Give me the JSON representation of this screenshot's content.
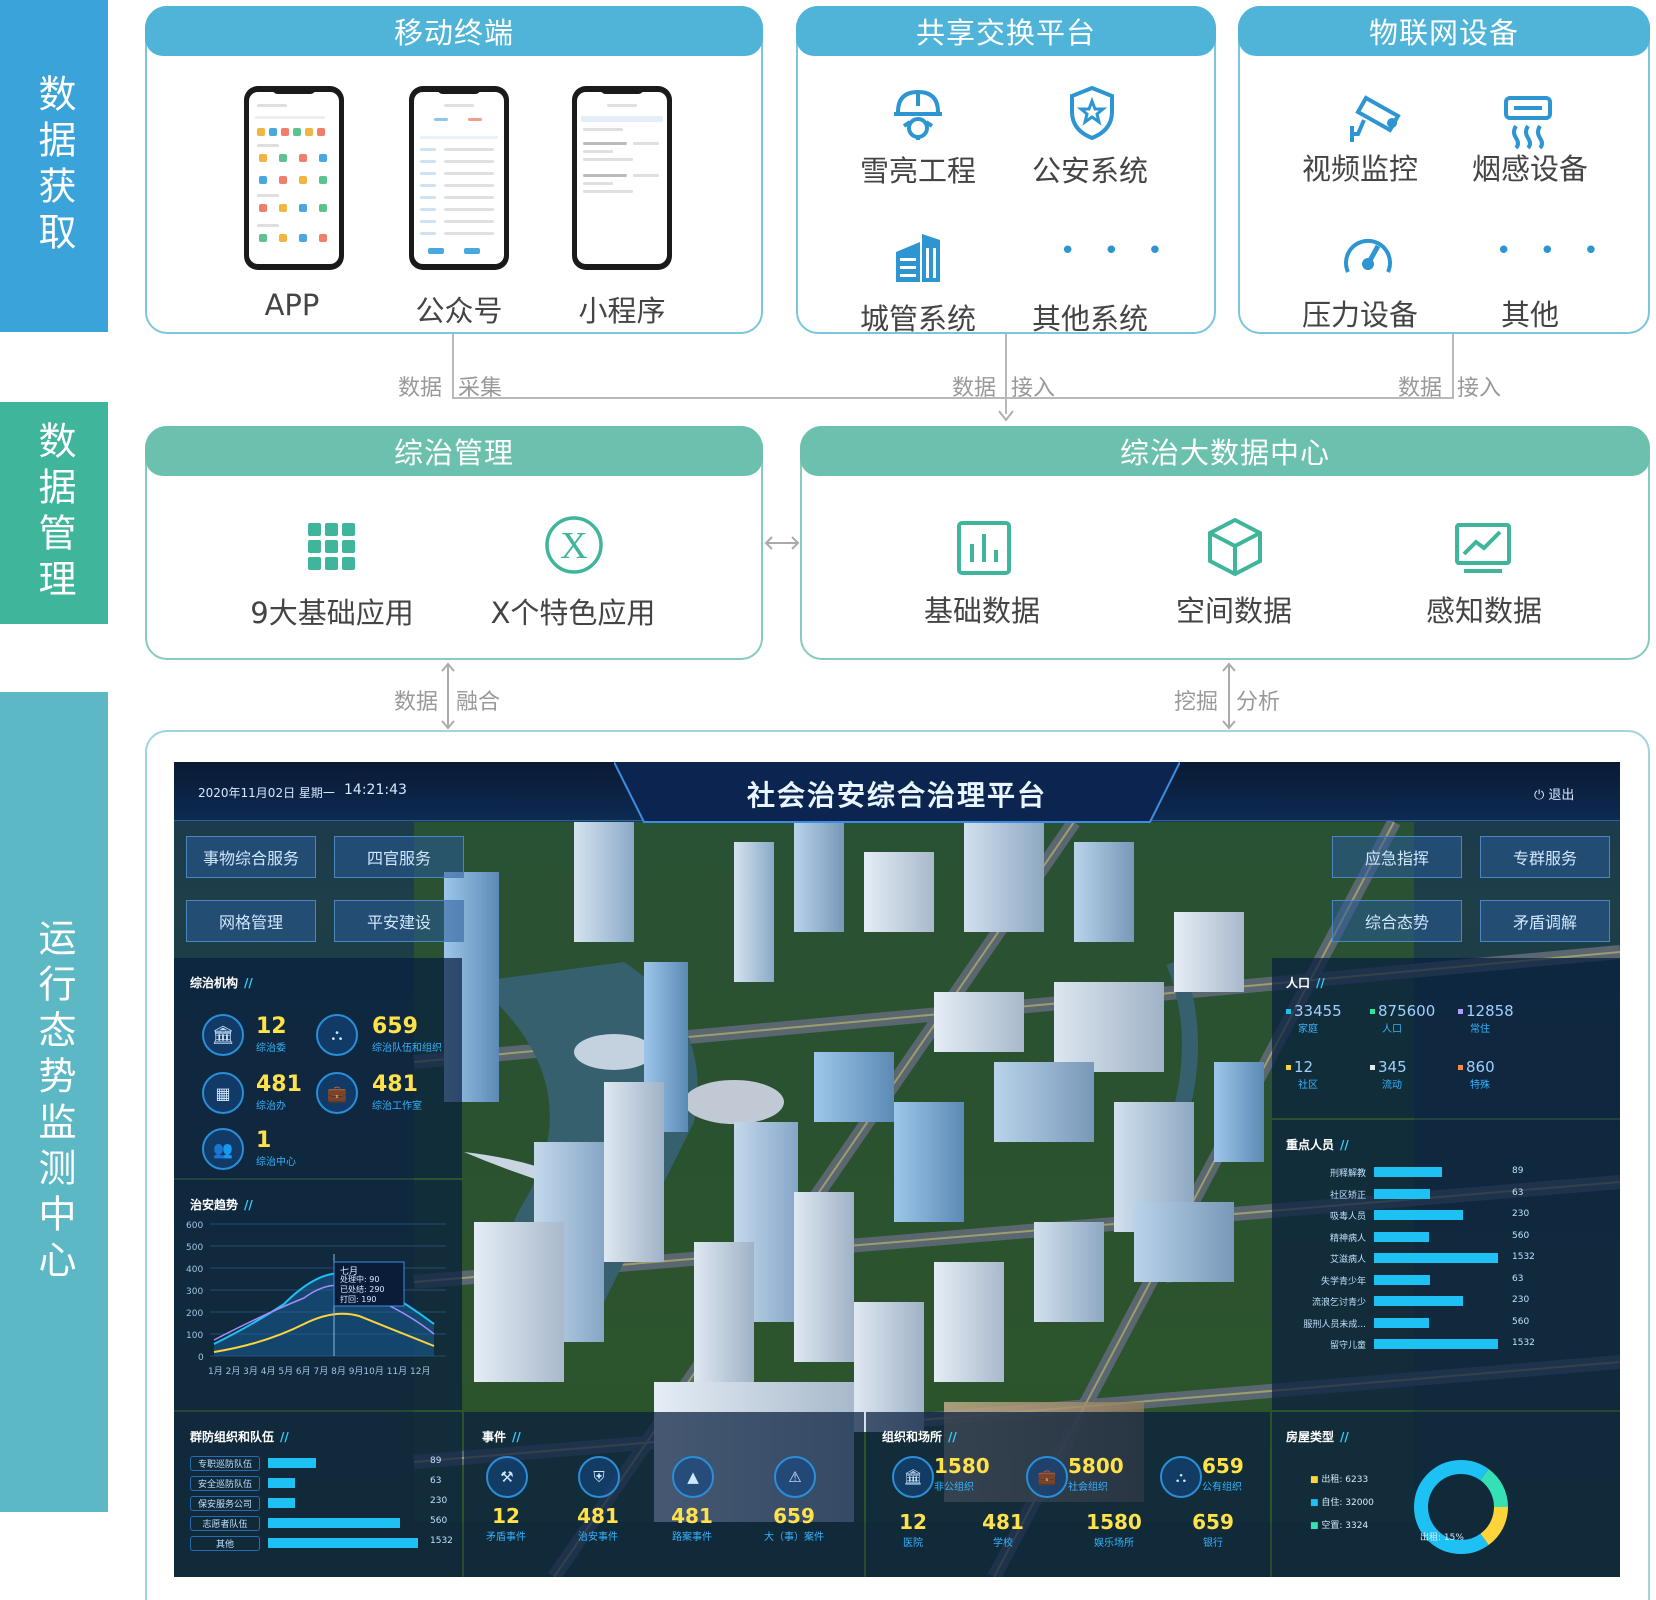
{
  "side": {
    "acquire": "数据获取",
    "manage": "数据管理",
    "monitor": "运行态势监测中心"
  },
  "colors": {
    "blue": "#3aa3d9",
    "green": "#3fb59c",
    "teal": "#5cb8c4"
  },
  "mobile": {
    "title": "移动终端",
    "items": [
      "APP",
      "公众号",
      "小程序"
    ]
  },
  "exchange": {
    "title": "共享交换平台",
    "items": [
      {
        "label": "雪亮工程",
        "icon": "helmet-gear-icon"
      },
      {
        "label": "公安系统",
        "icon": "shield-star-icon"
      },
      {
        "label": "城管系统",
        "icon": "buildings-icon"
      },
      {
        "label": "其他系统",
        "icon": "ellipsis-icon"
      }
    ]
  },
  "iot": {
    "title": "物联网设备",
    "items": [
      {
        "label": "视频监控",
        "icon": "camera-icon"
      },
      {
        "label": "烟感设备",
        "icon": "smoke-detector-icon"
      },
      {
        "label": "压力设备",
        "icon": "gauge-icon"
      },
      {
        "label": "其他",
        "icon": "ellipsis-icon"
      }
    ]
  },
  "flows": {
    "collect_a": "数据",
    "collect_b": "采集",
    "access1_a": "数据",
    "access1_b": "接入",
    "access2_a": "数据",
    "access2_b": "接入",
    "fuse_a": "数据",
    "fuse_b": "融合",
    "mine_a": "挖掘",
    "mine_b": "分析"
  },
  "comprehensive": {
    "title": "综治管理",
    "items": [
      {
        "label": "9大基础应用",
        "icon": "grid-icon"
      },
      {
        "label": "X个特色应用",
        "icon": "x-circle-icon"
      }
    ]
  },
  "bigdata": {
    "title": "综治大数据中心",
    "items": [
      {
        "label": "基础数据",
        "icon": "bar-chart-icon"
      },
      {
        "label": "空间数据",
        "icon": "cube-icon"
      },
      {
        "label": "感知数据",
        "icon": "line-chart-icon"
      }
    ]
  },
  "dashboard": {
    "date": "2020年11月02日  星期一",
    "time": "14:21:43",
    "title": "社会治安综合治理平台",
    "logout": "退出",
    "left_buttons": [
      "事物综合服务",
      "四官服务",
      "网格管理",
      "平安建设"
    ],
    "right_buttons": [
      "应急指挥",
      "专群服务",
      "综合态势",
      "矛盾调解"
    ],
    "org": {
      "title": "综治机构",
      "items": [
        {
          "value": "12",
          "label": "综治委"
        },
        {
          "value": "659",
          "label": "综治队伍和组织"
        },
        {
          "value": "481",
          "label": "综治办"
        },
        {
          "value": "481",
          "label": "综治工作室"
        },
        {
          "value": "1",
          "label": "综治中心"
        }
      ]
    },
    "trend": {
      "title": "治安趋势",
      "tooltip": {
        "month": "七月",
        "l1": "处理中: 90",
        "l2": "已处结: 290",
        "l3": "打回: 190"
      }
    },
    "population": {
      "title": "人口",
      "items": [
        {
          "value": "33455",
          "label": "家庭",
          "color": "#1ec1f3"
        },
        {
          "value": "875600",
          "label": "人口",
          "color": "#2fe39a"
        },
        {
          "value": "12858",
          "label": "常住",
          "color": "#b39cff"
        },
        {
          "value": "12",
          "label": "社区",
          "color": "#ffd43b"
        },
        {
          "value": "345",
          "label": "流动",
          "color": "#e6e6e6"
        },
        {
          "value": "860",
          "label": "特殊",
          "color": "#ff8a3d"
        }
      ]
    },
    "keypeople": {
      "title": "重点人员",
      "rows": [
        {
          "label": "刑释解教",
          "value": "89",
          "frac": 0.55
        },
        {
          "label": "社区矫正",
          "value": "63",
          "frac": 0.45
        },
        {
          "label": "吸毒人员",
          "value": "230",
          "frac": 0.72
        },
        {
          "label": "精神病人",
          "value": "560",
          "frac": 0.44
        },
        {
          "label": "艾滋病人",
          "value": "1532",
          "frac": 1.0
        },
        {
          "label": "失学青少年",
          "value": "63",
          "frac": 0.45
        },
        {
          "label": "流浪乞讨青少",
          "value": "230",
          "frac": 0.72
        },
        {
          "label": "服刑人员未成...",
          "value": "560",
          "frac": 0.44
        },
        {
          "label": "留守儿童",
          "value": "1532",
          "frac": 1.0
        }
      ]
    },
    "teams": {
      "title": "群防组织和队伍",
      "rows": [
        {
          "label": "专职巡防队伍",
          "value": "89",
          "frac": 0.32
        },
        {
          "label": "安全巡防队伍",
          "value": "63",
          "frac": 0.18
        },
        {
          "label": "保安服务公司",
          "value": "230",
          "frac": 0.18
        },
        {
          "label": "志愿者队伍",
          "value": "560",
          "frac": 0.88
        },
        {
          "label": "其他",
          "value": "1532",
          "frac": 1.0
        }
      ]
    },
    "events": {
      "title": "事件",
      "items": [
        {
          "value": "12",
          "label": "矛盾事件",
          "icon": "tool-icon"
        },
        {
          "value": "481",
          "label": "治安事件",
          "icon": "shield-icon"
        },
        {
          "value": "481",
          "label": "路案事件",
          "icon": "cone-icon"
        },
        {
          "value": "659",
          "label": "大（事）案件",
          "icon": "warning-icon"
        }
      ]
    },
    "orgs": {
      "title": "组织和场所",
      "top": [
        {
          "value": "1580",
          "label": "非公组织",
          "icon": "bank-icon"
        },
        {
          "value": "5800",
          "label": "社会组织",
          "icon": "briefcase-icon"
        },
        {
          "value": "659",
          "label": "公有组织",
          "icon": "org-chart-icon"
        }
      ],
      "bottom": [
        {
          "value": "12",
          "label": "医院"
        },
        {
          "value": "481",
          "label": "学校"
        },
        {
          "value": "1580",
          "label": "娱乐场所"
        },
        {
          "value": "659",
          "label": "银行"
        }
      ]
    },
    "housing": {
      "title": "房屋类型",
      "legend": [
        "出租: 6233",
        "自住: 32000",
        "空置: 3324"
      ],
      "center": "出租: 15%",
      "slices": [
        {
          "value": 15,
          "color": "#ffd43b"
        },
        {
          "value": 70,
          "color": "#1ec1f3"
        },
        {
          "value": 15,
          "color": "#35e0b4"
        }
      ]
    }
  }
}
